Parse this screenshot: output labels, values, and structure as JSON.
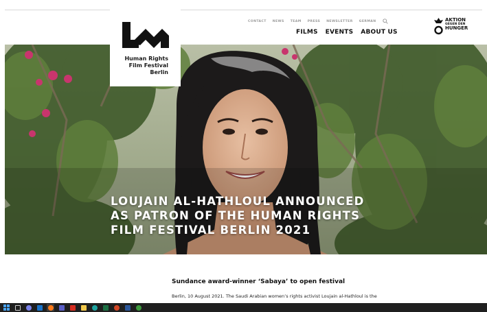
{
  "brand": {
    "logo_text": [
      "Human Rights",
      "Film Festival",
      "Berlin"
    ]
  },
  "nav": {
    "utility": [
      "CONTACT",
      "NEWS",
      "TEAM",
      "PRESS",
      "NEWSLETTER",
      "GERMAN"
    ],
    "main": [
      "FILMS",
      "EVENTS",
      "ABOUT US"
    ]
  },
  "partner": {
    "logo_text": [
      "AKTION",
      "GEGEN DEN",
      "HUNGER"
    ]
  },
  "hero": {
    "headline": [
      "LOUJAIN AL-HATHLOUL ANNOUNCED",
      "AS PATRON OF THE HUMAN RIGHTS",
      "FILM FESTIVAL BERLIN 2021"
    ]
  },
  "article": {
    "title": "Sundance award-winner ‘Sabaya’ to open festival",
    "lead": "Berlin, 10 August 2021. The Saudi Arabian women’s rights activist Loujain al-Hathloul is the"
  },
  "taskbar": {
    "icons": [
      "windows-start",
      "task-view",
      "chat",
      "outlook",
      "firefox",
      "teams",
      "acrobat",
      "file-explorer",
      "edge",
      "excel",
      "powerpoint",
      "word",
      "other-app"
    ]
  },
  "colors": {
    "text": "#111111",
    "muted": "#9a9a9a",
    "taskbar": "#1f1f1f",
    "foliage": "#4f6b35"
  }
}
